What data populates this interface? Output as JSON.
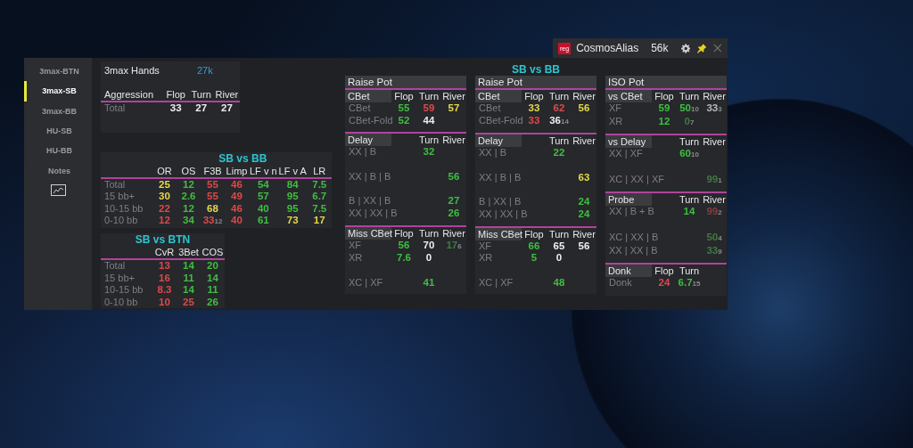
{
  "title_bar": {
    "badge": "reg",
    "name": "CosmosAlias",
    "hands": "56k"
  },
  "sidebar": {
    "items": [
      {
        "label": "3max-BTN",
        "selected": false
      },
      {
        "label": "3max-SB",
        "selected": true
      },
      {
        "label": "3max-BB",
        "selected": false
      },
      {
        "label": "HU-SB",
        "selected": false
      },
      {
        "label": "HU-BB",
        "selected": false
      },
      {
        "label": "Notes",
        "selected": false
      }
    ]
  },
  "hands": {
    "label": "3max Hands",
    "value": "27k"
  },
  "aggression": {
    "title": "Aggression",
    "columns": [
      "Flop",
      "Turn",
      "River"
    ],
    "rows": [
      {
        "label": "Total",
        "cells": [
          {
            "v": "33",
            "color": "#eeeeee"
          },
          {
            "v": "27",
            "color": "#eeeeee"
          },
          {
            "v": "27",
            "color": "#eeeeee"
          }
        ]
      }
    ]
  },
  "preflop": {
    "title": "SB vs BB",
    "columns": [
      "OR",
      "OS",
      "F3B",
      "Limp",
      "LF v n",
      "LF v A",
      "LR"
    ],
    "rows": [
      {
        "label": "Total",
        "cells": [
          {
            "v": "25",
            "color": "#e6d84a"
          },
          {
            "v": "12",
            "color": "#3fbf3f"
          },
          {
            "v": "55",
            "color": "#e04848"
          },
          {
            "v": "46",
            "color": "#e04848"
          },
          {
            "v": "54",
            "color": "#3fbf3f"
          },
          {
            "v": "84",
            "color": "#3fbf3f"
          },
          {
            "v": "7.5",
            "color": "#3fbf3f"
          }
        ]
      },
      {
        "label": "15 bb+",
        "cells": [
          {
            "v": "30",
            "color": "#e6d84a"
          },
          {
            "v": "2.6",
            "color": "#3fbf3f"
          },
          {
            "v": "55",
            "color": "#e04848"
          },
          {
            "v": "49",
            "color": "#e04848"
          },
          {
            "v": "57",
            "color": "#3fbf3f"
          },
          {
            "v": "95",
            "color": "#3fbf3f"
          },
          {
            "v": "6.7",
            "color": "#3fbf3f"
          }
        ]
      },
      {
        "label": "10-15 bb",
        "cells": [
          {
            "v": "22",
            "color": "#e04848"
          },
          {
            "v": "12",
            "color": "#3fbf3f"
          },
          {
            "v": "68",
            "color": "#e6d84a"
          },
          {
            "v": "46",
            "color": "#e04848"
          },
          {
            "v": "40",
            "color": "#3fbf3f"
          },
          {
            "v": "95",
            "color": "#3fbf3f"
          },
          {
            "v": "7.5",
            "color": "#3fbf3f"
          }
        ]
      },
      {
        "label": "0-10 bb",
        "cells": [
          {
            "v": "12",
            "color": "#e04848"
          },
          {
            "v": "34",
            "color": "#3fbf3f"
          },
          {
            "v": "33",
            "s": "12",
            "color": "#e04848"
          },
          {
            "v": "40",
            "color": "#e04848"
          },
          {
            "v": "61",
            "color": "#3fbf3f"
          },
          {
            "v": "73",
            "color": "#e6d84a"
          },
          {
            "v": "17",
            "color": "#e6d84a"
          }
        ]
      }
    ]
  },
  "vs_btn": {
    "title": "SB vs BTN",
    "columns": [
      "CvR",
      "3Bet",
      "COS"
    ],
    "rows": [
      {
        "label": "Total",
        "cells": [
          {
            "v": "13",
            "color": "#e04848"
          },
          {
            "v": "14",
            "color": "#3fbf3f"
          },
          {
            "v": "20",
            "color": "#3fbf3f"
          }
        ]
      },
      {
        "label": "15 bb+",
        "cells": [
          {
            "v": "16",
            "color": "#e04848"
          },
          {
            "v": "11",
            "color": "#3fbf3f"
          },
          {
            "v": "14",
            "color": "#3fbf3f"
          }
        ]
      },
      {
        "label": "10-15 bb",
        "cells": [
          {
            "v": "8.3",
            "color": "#e04848"
          },
          {
            "v": "14",
            "color": "#3fbf3f"
          },
          {
            "v": "11",
            "color": "#3fbf3f"
          }
        ]
      },
      {
        "label": "0-10 bb",
        "cells": [
          {
            "v": "10",
            "color": "#e04848"
          },
          {
            "v": "25",
            "color": "#e04848"
          },
          {
            "v": "26",
            "color": "#3fbf3f"
          }
        ]
      }
    ]
  },
  "postflop": [
    {
      "heading": "Raise Pot",
      "tables": [
        {
          "title": "CBet",
          "columns": [
            "Flop",
            "Turn",
            "River"
          ],
          "rows": [
            {
              "label": "CBet",
              "cells": [
                {
                  "v": "55",
                  "color": "#3fbf3f"
                },
                {
                  "v": "59",
                  "color": "#e04848"
                },
                {
                  "v": "57",
                  "color": "#e6d84a"
                }
              ]
            },
            {
              "label": "CBet-Fold",
              "cells": [
                {
                  "v": "52",
                  "color": "#3fbf3f"
                },
                {
                  "v": "44",
                  "color": "#eeeeee"
                },
                null
              ]
            }
          ]
        },
        {
          "title": "Delay",
          "columns": [
            null,
            "Turn",
            "River"
          ],
          "rows": [
            {
              "label": "XX | B",
              "cells": [
                null,
                {
                  "v": "32",
                  "color": "#3fbf3f"
                },
                null
              ]
            },
            {
              "label": "XX | B | B",
              "spaced": true,
              "cells": [
                null,
                null,
                {
                  "v": "56",
                  "color": "#3fbf3f"
                }
              ]
            },
            {
              "label": "B | XX | B",
              "spaced": true,
              "cells": [
                null,
                null,
                {
                  "v": "27",
                  "color": "#3fbf3f"
                }
              ]
            },
            {
              "label": "XX | XX | B",
              "cells": [
                null,
                null,
                {
                  "v": "26",
                  "color": "#3fbf3f"
                }
              ]
            }
          ]
        },
        {
          "title": "Miss CBet",
          "columns": [
            "Flop",
            "Turn",
            "River"
          ],
          "rows": [
            {
              "label": "XF",
              "cells": [
                {
                  "v": "56",
                  "color": "#3fbf3f"
                },
                {
                  "v": "70",
                  "color": "#eeeeee"
                },
                {
                  "v": "17",
                  "s": "6",
                  "color": "#3f7a3f"
                }
              ]
            },
            {
              "label": "XR",
              "cells": [
                {
                  "v": "7.6",
                  "color": "#3fbf3f"
                },
                {
                  "v": "0",
                  "color": "#eeeeee"
                },
                null
              ]
            },
            {
              "label": "XC | XF",
              "spaced": true,
              "cells": [
                null,
                {
                  "v": "41",
                  "color": "#3fbf3f"
                },
                null
              ]
            }
          ]
        }
      ]
    },
    {
      "title": "SB vs BB",
      "heading": "Raise Pot",
      "tables": [
        {
          "title": "CBet",
          "columns": [
            "Flop",
            "Turn",
            "River"
          ],
          "rows": [
            {
              "label": "CBet",
              "cells": [
                {
                  "v": "33",
                  "color": "#e6d84a"
                },
                {
                  "v": "62",
                  "color": "#e04848"
                },
                {
                  "v": "56",
                  "color": "#e6d84a"
                }
              ]
            },
            {
              "label": "CBet-Fold",
              "cells": [
                {
                  "v": "33",
                  "color": "#e04848"
                },
                {
                  "v": "36",
                  "s": "14",
                  "color": "#eeeeee"
                },
                null
              ]
            }
          ]
        },
        {
          "title": "Delay",
          "columns": [
            null,
            "Turn",
            "River"
          ],
          "rows": [
            {
              "label": "XX | B",
              "cells": [
                null,
                {
                  "v": "22",
                  "color": "#3fbf3f"
                },
                null
              ]
            },
            {
              "label": "XX | B | B",
              "spaced": true,
              "cells": [
                null,
                null,
                {
                  "v": "63",
                  "color": "#e6d84a"
                }
              ]
            },
            {
              "label": "B | XX | B",
              "spaced": true,
              "cells": [
                null,
                null,
                {
                  "v": "24",
                  "color": "#3fbf3f"
                }
              ]
            },
            {
              "label": "XX | XX | B",
              "cells": [
                null,
                null,
                {
                  "v": "24",
                  "color": "#3fbf3f"
                }
              ]
            }
          ]
        },
        {
          "title": "Miss CBet",
          "columns": [
            "Flop",
            "Turn",
            "River"
          ],
          "rows": [
            {
              "label": "XF",
              "cells": [
                {
                  "v": "66",
                  "color": "#3fbf3f"
                },
                {
                  "v": "65",
                  "color": "#eeeeee"
                },
                {
                  "v": "56",
                  "color": "#eeeeee"
                }
              ]
            },
            {
              "label": "XR",
              "cells": [
                {
                  "v": "5",
                  "color": "#3fbf3f"
                },
                {
                  "v": "0",
                  "color": "#eeeeee"
                },
                null
              ]
            },
            {
              "label": "XC | XF",
              "spaced": true,
              "cells": [
                null,
                {
                  "v": "48",
                  "color": "#3fbf3f"
                },
                null
              ]
            }
          ]
        }
      ]
    },
    {
      "heading": "ISO Pot",
      "tables": [
        {
          "title": "vs CBet",
          "columns": [
            "Flop",
            "Turn",
            "River"
          ],
          "rows": [
            {
              "label": "XF",
              "cells": [
                {
                  "v": "59",
                  "color": "#3fbf3f"
                },
                {
                  "v": "50",
                  "s": "10",
                  "color": "#3fbf3f"
                },
                {
                  "v": "33",
                  "s": "3",
                  "color": "#b8b8b8"
                }
              ]
            },
            {
              "label": "XR",
              "cells": [
                {
                  "v": "12",
                  "color": "#3fbf3f"
                },
                {
                  "v": "0",
                  "s": "7",
                  "color": "#3f7a3f"
                },
                null
              ]
            }
          ]
        },
        {
          "title": "vs Delay",
          "columns": [
            null,
            "Turn",
            "River"
          ],
          "rows": [
            {
              "label": "XX | XF",
              "cells": [
                null,
                {
                  "v": "60",
                  "s": "10",
                  "color": "#3fbf3f"
                },
                null
              ]
            },
            {
              "label": "XC | XX | XF",
              "spaced": true,
              "cells": [
                null,
                null,
                {
                  "v": "99",
                  "s": "1",
                  "color": "#3f7a3f"
                }
              ]
            }
          ]
        },
        {
          "title": "Probe",
          "columns": [
            null,
            "Turn",
            "River"
          ],
          "rows": [
            {
              "label": "XX | B + B",
              "cells": [
                null,
                {
                  "v": "14",
                  "color": "#3fbf3f"
                },
                {
                  "v": "99",
                  "s": "2",
                  "color": "#8a3c3c"
                }
              ]
            },
            {
              "label": "XC | XX | B",
              "spaced": true,
              "cells": [
                null,
                null,
                {
                  "v": "50",
                  "s": "4",
                  "color": "#3f7a3f"
                }
              ]
            },
            {
              "label": "XX | XX | B",
              "cells": [
                null,
                null,
                {
                  "v": "33",
                  "s": "9",
                  "color": "#3f7a3f"
                }
              ]
            }
          ]
        },
        {
          "title": "Donk",
          "columns": [
            "Flop",
            "Turn",
            null
          ],
          "rows": [
            {
              "label": "Donk",
              "cells": [
                {
                  "v": "24",
                  "color": "#e04848"
                },
                {
                  "v": "6.7",
                  "s": "15",
                  "color": "#3fbf3f"
                },
                null
              ]
            }
          ]
        }
      ]
    }
  ]
}
